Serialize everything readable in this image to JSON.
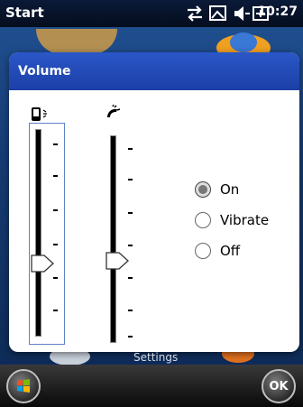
{
  "status_bar": {
    "title": "Start",
    "time": "10:27",
    "icons": [
      "connectivity-icon",
      "messaging-icon",
      "speaker-icon",
      "battery-icon"
    ]
  },
  "dialog": {
    "title": "Volume",
    "device_slider": {
      "icon": "phone-device-icon",
      "level": 0.45
    },
    "ringer_slider": {
      "icon": "ringer-icon",
      "level": 0.45
    },
    "options": [
      {
        "label": "On",
        "selected": true
      },
      {
        "label": "Vibrate",
        "selected": false
      },
      {
        "label": "Off",
        "selected": false
      }
    ]
  },
  "background": {
    "label": "Settings"
  },
  "bottom_bar": {
    "left_icon": "windows-start-icon",
    "right_button": "OK"
  }
}
